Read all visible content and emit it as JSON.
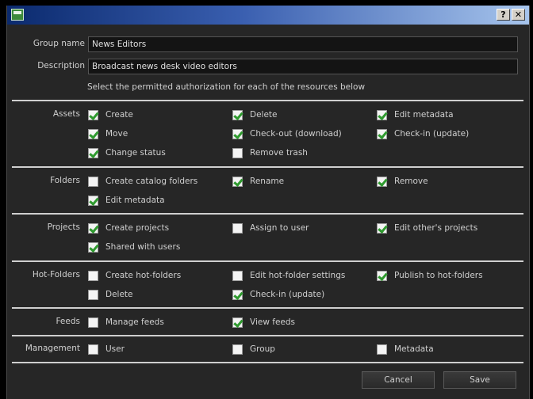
{
  "window": {
    "help_label": "?",
    "close_label": "✕"
  },
  "form": {
    "group_name_label": "Group name",
    "group_name_value": "News Editors",
    "description_label": "Description",
    "description_value": "Broadcast news desk video editors",
    "hint": "Select the permitted authorization for each of the resources below"
  },
  "sections": [
    {
      "label": "Assets",
      "items": [
        {
          "label": "Create",
          "checked": true
        },
        {
          "label": "Delete",
          "checked": true
        },
        {
          "label": "Edit metadata",
          "checked": true
        },
        {
          "label": "Move",
          "checked": true
        },
        {
          "label": "Check-out (download)",
          "checked": true
        },
        {
          "label": "Check-in (update)",
          "checked": true
        },
        {
          "label": "Change status",
          "checked": true
        },
        {
          "label": "Remove trash",
          "checked": false
        }
      ]
    },
    {
      "label": "Folders",
      "items": [
        {
          "label": "Create catalog folders",
          "checked": false
        },
        {
          "label": "Rename",
          "checked": true
        },
        {
          "label": "Remove",
          "checked": true
        },
        {
          "label": "Edit metadata",
          "checked": true
        }
      ]
    },
    {
      "label": "Projects",
      "items": [
        {
          "label": "Create projects",
          "checked": true
        },
        {
          "label": "Assign to user",
          "checked": false
        },
        {
          "label": "Edit other's projects",
          "checked": true
        },
        {
          "label": "Shared with users",
          "checked": true
        }
      ]
    },
    {
      "label": "Hot-Folders",
      "items": [
        {
          "label": "Create hot-folders",
          "checked": false
        },
        {
          "label": "Edit hot-folder settings",
          "checked": false
        },
        {
          "label": "Publish to hot-folders",
          "checked": true
        },
        {
          "label": "Delete",
          "checked": false
        },
        {
          "label": "Check-in (update)",
          "checked": true
        }
      ]
    },
    {
      "label": "Feeds",
      "items": [
        {
          "label": "Manage feeds",
          "checked": false
        },
        {
          "label": "View feeds",
          "checked": true
        }
      ]
    },
    {
      "label": "Management",
      "items": [
        {
          "label": "User",
          "checked": false
        },
        {
          "label": "Group",
          "checked": false
        },
        {
          "label": "Metadata",
          "checked": false
        }
      ]
    }
  ],
  "buttons": {
    "cancel": "Cancel",
    "save": "Save"
  },
  "colors": {
    "title_gradient_start": "#0b2a6e",
    "title_gradient_end": "#a6c4ec",
    "check": "#2f9a2f",
    "panel": "#262626"
  }
}
